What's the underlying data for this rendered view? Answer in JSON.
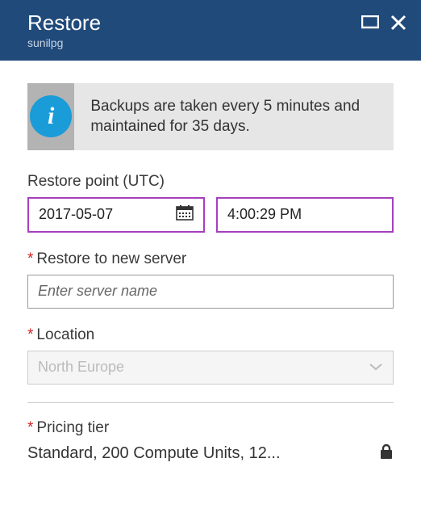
{
  "header": {
    "title": "Restore",
    "subtitle": "sunilpg"
  },
  "info": {
    "glyph": "i",
    "text": "Backups are taken every 5 minutes and maintained for 35 days."
  },
  "restore_point": {
    "label": "Restore point (UTC)",
    "date": "2017-05-07",
    "time": "4:00:29 PM"
  },
  "new_server": {
    "label": "Restore to new server",
    "placeholder": "Enter server name",
    "value": ""
  },
  "location": {
    "label": "Location",
    "value": "North Europe"
  },
  "pricing": {
    "label": "Pricing tier",
    "value": "Standard, 200 Compute Units, 12..."
  },
  "colors": {
    "header_bg": "#204a7a",
    "accent_purple": "#a63fbf",
    "info_blue": "#1a9cd8"
  }
}
